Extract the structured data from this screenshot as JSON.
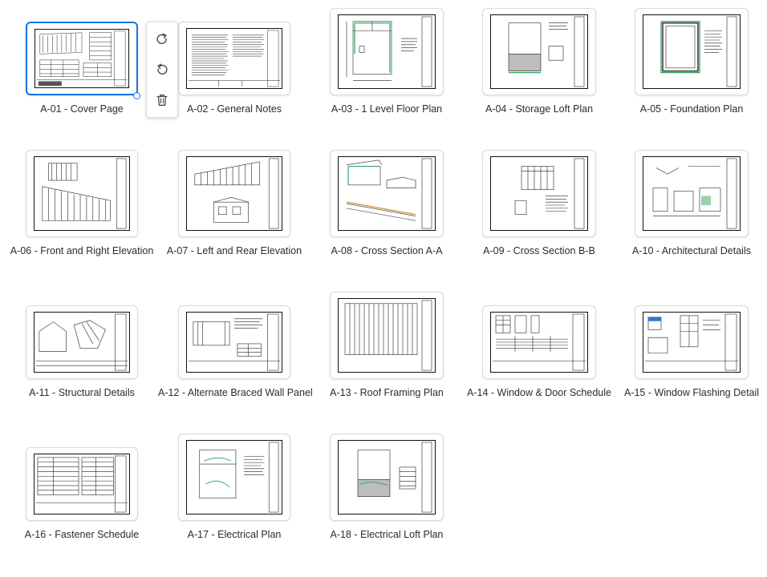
{
  "toolbar": {
    "rotate_clockwise_icon": "rotate-clockwise-icon",
    "rotate_counterclockwise_icon": "rotate-counterclockwise-icon",
    "delete_icon": "trash-icon"
  },
  "accent_color": "#1473e6",
  "pages": [
    {
      "label": "A-01 - Cover Page",
      "selected": true
    },
    {
      "label": "A-02 - General Notes"
    },
    {
      "label": "A-03 - 1 Level Floor Plan"
    },
    {
      "label": "A-04 - Storage Loft Plan"
    },
    {
      "label": "A-05 - Foundation Plan"
    },
    {
      "label": "A-06 - Front and Right  Elevation"
    },
    {
      "label": "A-07 - Left and Rear Elevation"
    },
    {
      "label": "A-08 - Cross Section A-A"
    },
    {
      "label": "A-09 - Cross Section B-B"
    },
    {
      "label": "A-10 - Architectural Details"
    },
    {
      "label": "A-11 - Structural Details"
    },
    {
      "label": "A-12 - Alternate Braced Wall Panel"
    },
    {
      "label": "A-13 - Roof Framing Plan"
    },
    {
      "label": "A-14 - Window & Door Schedule"
    },
    {
      "label": "A-15 - Window Flashing Detail"
    },
    {
      "label": "A-16 - Fastener Schedule"
    },
    {
      "label": "A-17 - Electrical Plan"
    },
    {
      "label": "A-18 - Electrical Loft  Plan"
    }
  ]
}
